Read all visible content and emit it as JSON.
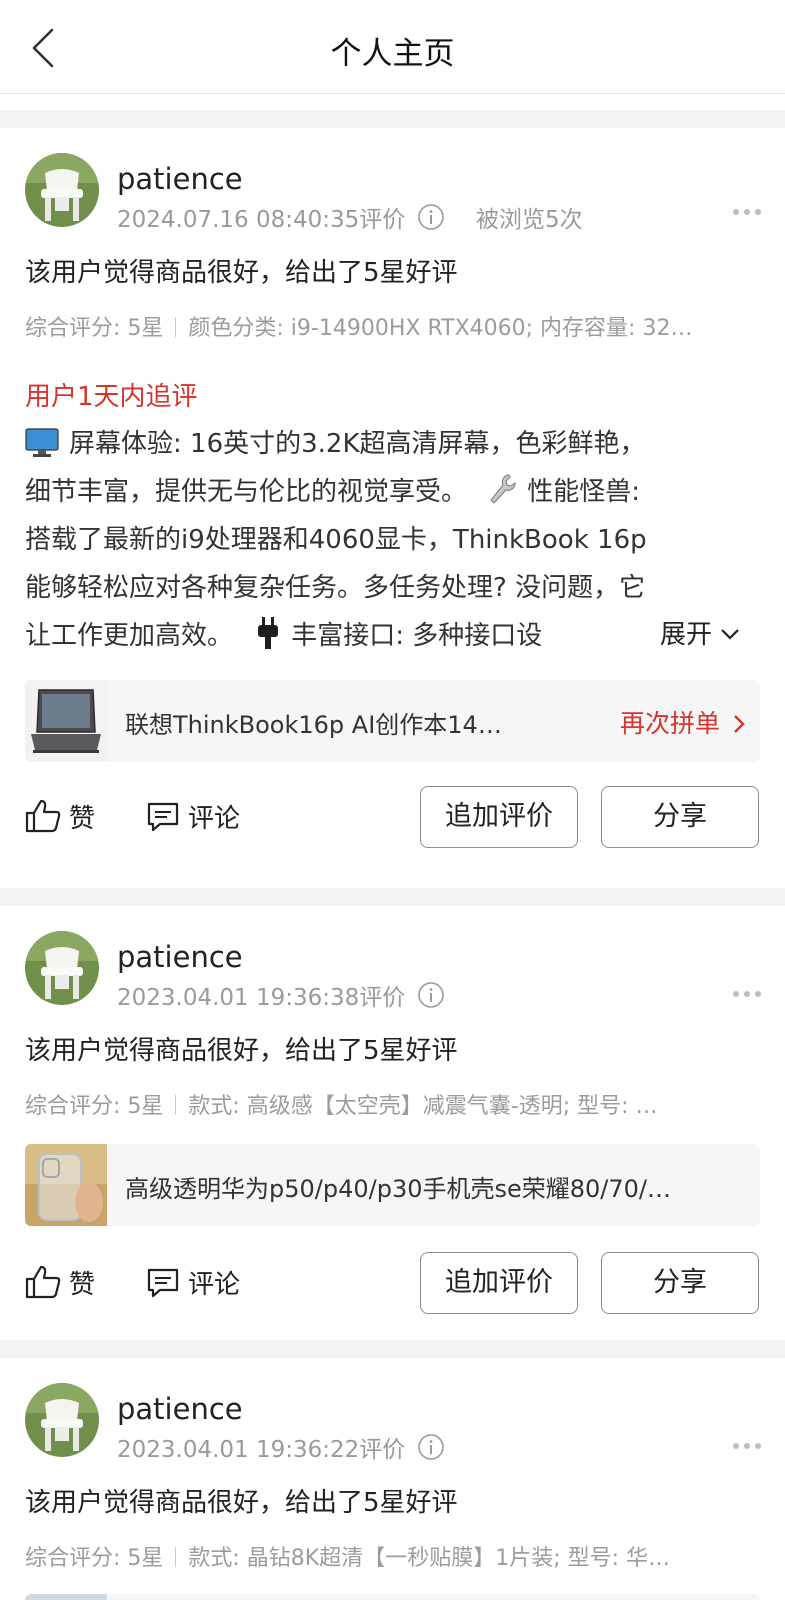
{
  "header": {
    "title": "个人主页"
  },
  "reviews": [
    {
      "username": "patience",
      "timestamp": "2024.07.16 08:40:35评价",
      "views": "被浏览5次",
      "summary": "该用户觉得商品很好，给出了5星好评",
      "rating": "综合评分: 5星",
      "specs": "颜色分类: i9-14900HX RTX4060; 内存容量: 32…",
      "followup_title": "用户1天内追评",
      "followup_lines": [
        "屏幕体验: 16英寸的3.2K超高清屏幕，色彩鲜艳，",
        "细节丰富，提供无与伦比的视觉享受。",
        "性能怪兽:",
        "搭载了最新的i9处理器和4060显卡，ThinkBook 16p",
        "能够轻松应对各种复杂任务。多任务处理? 没问题，它",
        "让工作更加高效。",
        "丰富接口: 多种接口设"
      ],
      "expand_label": "展开",
      "product_name": "联想ThinkBook16p AI创作本14…",
      "product_action": "再次拼单",
      "like_label": "赞",
      "comment_label": "评论",
      "add_review_label": "追加评价",
      "share_label": "分享"
    },
    {
      "username": "patience",
      "timestamp": "2023.04.01 19:36:38评价",
      "summary": "该用户觉得商品很好，给出了5星好评",
      "rating": "综合评分: 5星",
      "specs": "款式: 高级感【太空壳】减震气囊-透明; 型号: …",
      "product_name": "高级透明华为p50/p40/p30手机壳se荣耀80/70/…",
      "like_label": "赞",
      "comment_label": "评论",
      "add_review_label": "追加评价",
      "share_label": "分享"
    },
    {
      "username": "patience",
      "timestamp": "2023.04.01 19:36:22评价",
      "summary": "该用户觉得商品很好，给出了5星好评",
      "rating": "综合评分: 5星",
      "specs": "款式: 晶钻8K超清【一秒贴膜】1片装; 型号: 华…"
    }
  ],
  "colors": {
    "accent": "#d6342d",
    "muted": "#9a9a9a",
    "divider": "#f2f2f2"
  },
  "icons": [
    "back-arrow-icon",
    "info-icon",
    "more-dots-icon",
    "thumbs-up-icon",
    "comment-icon",
    "monitor-emoji-icon",
    "wrench-emoji-icon",
    "plug-emoji-icon",
    "chevron-down-icon",
    "chevron-right-icon"
  ]
}
